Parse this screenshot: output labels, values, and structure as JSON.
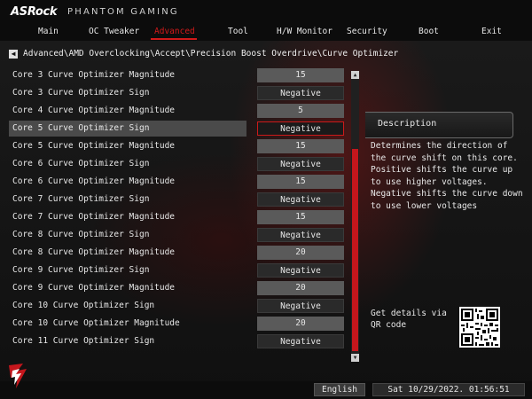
{
  "brand": {
    "logo": "ASRock",
    "subtitle": "PHANTOM GAMING"
  },
  "tabs": [
    {
      "label": "Main"
    },
    {
      "label": "OC Tweaker"
    },
    {
      "label": "Advanced",
      "active": true
    },
    {
      "label": "Tool"
    },
    {
      "label": "H/W Monitor"
    },
    {
      "label": "Security"
    },
    {
      "label": "Boot"
    },
    {
      "label": "Exit"
    }
  ],
  "breadcrumb": "Advanced\\AMD Overclocking\\Accept\\Precision Boost Overdrive\\Curve Optimizer",
  "items": [
    {
      "label": "Core 3 Curve Optimizer Magnitude",
      "value": "15"
    },
    {
      "label": "Core 3 Curve Optimizer Sign",
      "value": "Negative"
    },
    {
      "label": "Core 4 Curve Optimizer Magnitude",
      "value": "5"
    },
    {
      "label": "Core 5 Curve Optimizer Sign",
      "value": "Negative",
      "selected": true
    },
    {
      "label": "Core 5 Curve Optimizer Magnitude",
      "value": "15"
    },
    {
      "label": "Core 6 Curve Optimizer Sign",
      "value": "Negative"
    },
    {
      "label": "Core 6 Curve Optimizer Magnitude",
      "value": "15"
    },
    {
      "label": "Core 7 Curve Optimizer Sign",
      "value": "Negative"
    },
    {
      "label": "Core 7 Curve Optimizer Magnitude",
      "value": "15"
    },
    {
      "label": "Core 8 Curve Optimizer Sign",
      "value": "Negative"
    },
    {
      "label": "Core 8 Curve Optimizer Magnitude",
      "value": "20"
    },
    {
      "label": "Core 9 Curve Optimizer Sign",
      "value": "Negative"
    },
    {
      "label": "Core 9 Curve Optimizer Magnitude",
      "value": "20"
    },
    {
      "label": "Core 10 Curve Optimizer Sign",
      "value": "Negative"
    },
    {
      "label": "Core 10 Curve Optimizer Magnitude",
      "value": "20"
    },
    {
      "label": "Core 11 Curve Optimizer Sign",
      "value": "Negative"
    }
  ],
  "description": {
    "title": "Description",
    "text": "Determines the direction of the curve shift on this core. Positive shifts the curve up to use higher voltages. Negative shifts the curve down to use lower voltages"
  },
  "qr": {
    "text": "Get details via QR code"
  },
  "footer": {
    "language": "English",
    "datetime": "Sat 10/29/2022. 01:56:51"
  },
  "colors": {
    "accent": "#d11a1a",
    "background": "#141414",
    "value_bg": "#5a5a5a"
  },
  "icons": {
    "back": "left-arrow-icon",
    "scroll_up": "up-arrow-icon",
    "scroll_down": "down-arrow-icon",
    "footer_logo": "phantom-gaming-logo-icon"
  }
}
